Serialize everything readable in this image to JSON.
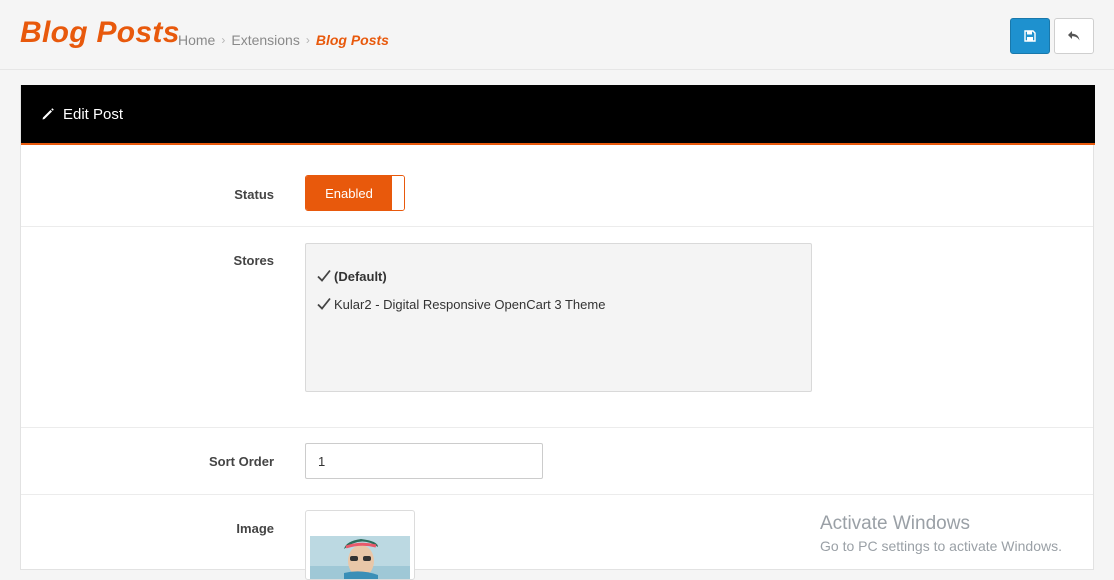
{
  "header": {
    "title": "Blog Posts",
    "breadcrumb": [
      {
        "label": "Home"
      },
      {
        "label": "Extensions"
      },
      {
        "label": "Blog Posts"
      }
    ],
    "separator": "›",
    "accent_color": "#e8590c",
    "save_button_icon": "save-icon",
    "back_button_icon": "reply-icon"
  },
  "panel": {
    "heading_icon": "pencil-icon",
    "heading": "Edit Post"
  },
  "form": {
    "status": {
      "label": "Status",
      "value": "Enabled"
    },
    "stores": {
      "label": "Stores",
      "options": [
        {
          "label": "(Default)",
          "checked": true
        },
        {
          "label": "Kular2 - Digital Responsive OpenCart 3 Theme",
          "checked": true
        }
      ]
    },
    "sort_order": {
      "label": "Sort Order",
      "value": "1"
    },
    "image": {
      "label": "Image"
    }
  },
  "watermark": {
    "title": "Activate Windows",
    "subtitle": "Go to PC settings to activate Windows."
  }
}
